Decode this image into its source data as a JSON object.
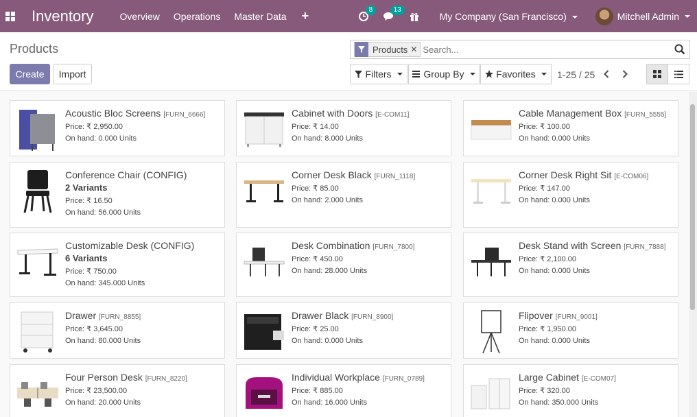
{
  "navbar": {
    "app_title": "Inventory",
    "menu": [
      "Overview",
      "Operations",
      "Master Data"
    ],
    "plus_label": "+",
    "activity_count": "8",
    "message_count": "13",
    "company": "My Company (San Francisco)",
    "user": "Mitchell Admin"
  },
  "control": {
    "title": "Products",
    "create_label": "Create",
    "import_label": "Import",
    "facet_label": "Products",
    "facet_close": "✕",
    "search_placeholder": "Search...",
    "filters_label": "Filters",
    "groupby_label": "Group By",
    "favorites_label": "Favorites",
    "pager": "1-25 / 25"
  },
  "products": [
    {
      "name": "Acoustic Bloc Screens",
      "code": "[FURN_6666]",
      "variants": "",
      "price": "Price: ₹ 2,950.00",
      "onhand": "On hand: 0.000 Units",
      "icon": "acoustic-screen"
    },
    {
      "name": "Cabinet with Doors",
      "code": "[E-COM11]",
      "variants": "",
      "price": "Price: ₹ 14.00",
      "onhand": "On hand: 8.000 Units",
      "icon": "cabinet"
    },
    {
      "name": "Cable Management Box",
      "code": "[FURN_5555]",
      "variants": "",
      "price": "Price: ₹ 100.00",
      "onhand": "On hand: 0.000 Units",
      "icon": "cable-box"
    },
    {
      "name": "Conference Chair (CONFIG)",
      "code": "",
      "variants": "2 Variants",
      "price": "Price: ₹ 16.50",
      "onhand": "On hand: 56.000 Units",
      "icon": "chair"
    },
    {
      "name": "Corner Desk Black",
      "code": "[FURN_1118]",
      "variants": "",
      "price": "Price: ₹ 85.00",
      "onhand": "On hand: 2.000 Units",
      "icon": "desk-black"
    },
    {
      "name": "Corner Desk Right Sit",
      "code": "[E-COM06]",
      "variants": "",
      "price": "Price: ₹ 147.00",
      "onhand": "On hand: 0.000 Units",
      "icon": "desk-light"
    },
    {
      "name": "Customizable Desk (CONFIG)",
      "code": "",
      "variants": "6 Variants",
      "price": "Price: ₹ 750.00",
      "onhand": "On hand: 345.000 Units",
      "icon": "desk-white"
    },
    {
      "name": "Desk Combination",
      "code": "[FURN_7800]",
      "variants": "",
      "price": "Price: ₹ 450.00",
      "onhand": "On hand: 28.000 Units",
      "icon": "desk-combo"
    },
    {
      "name": "Desk Stand with Screen",
      "code": "[FURN_7888]",
      "variants": "",
      "price": "Price: ₹ 2,100.00",
      "onhand": "On hand: 0.000 Units",
      "icon": "desk-screen"
    },
    {
      "name": "Drawer",
      "code": "[FURN_8855]",
      "variants": "",
      "price": "Price: ₹ 3,645.00",
      "onhand": "On hand: 80.000 Units",
      "icon": "drawer-white"
    },
    {
      "name": "Drawer Black",
      "code": "[FURN_8900]",
      "variants": "",
      "price": "Price: ₹ 25.00",
      "onhand": "On hand: 0.000 Units",
      "icon": "drawer-black"
    },
    {
      "name": "Flipover",
      "code": "[FURN_9001]",
      "variants": "",
      "price": "Price: ₹ 1,950.00",
      "onhand": "On hand: 0.000 Units",
      "icon": "flipover"
    },
    {
      "name": "Four Person Desk",
      "code": "[FURN_8220]",
      "variants": "",
      "price": "Price: ₹ 23,500.00",
      "onhand": "On hand: 20.000 Units",
      "icon": "four-person-desk"
    },
    {
      "name": "Individual Workplace",
      "code": "[FURN_0789]",
      "variants": "",
      "price": "Price: ₹ 885.00",
      "onhand": "On hand: 16.000 Units",
      "icon": "workplace"
    },
    {
      "name": "Large Cabinet",
      "code": "[E-COM07]",
      "variants": "",
      "price": "Price: ₹ 320.00",
      "onhand": "On hand: 350.000 Units",
      "icon": "large-cabinet"
    }
  ],
  "colors": {
    "navbar": "#875a7b",
    "primary": "#7c7bad",
    "badge": "#00a09d"
  }
}
